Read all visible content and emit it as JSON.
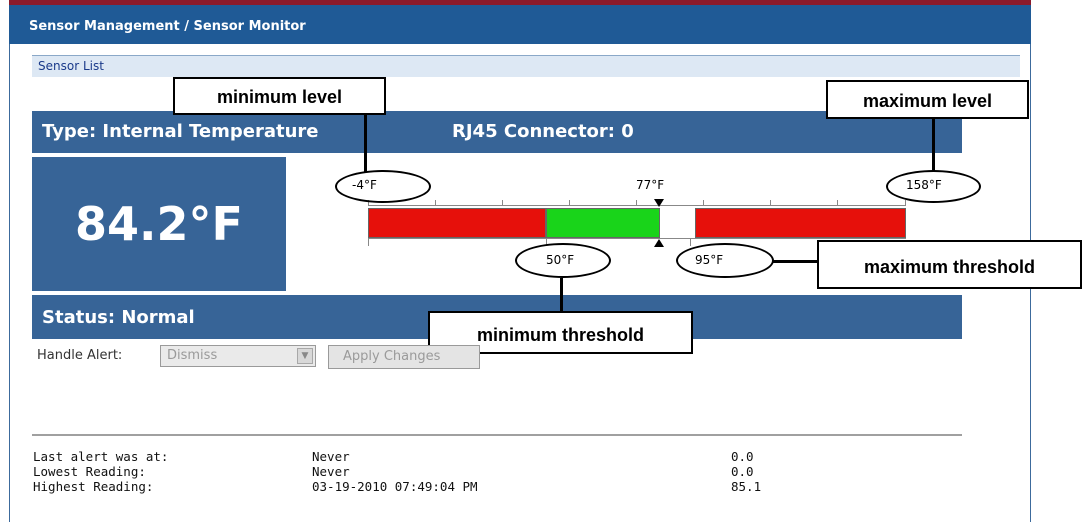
{
  "header": {
    "title": "Sensor Management / Sensor Monitor"
  },
  "nav": {
    "sensor_list_link": "Sensor List"
  },
  "sensor": {
    "type_label": "Type: Internal Temperature",
    "connector_label": "RJ45 Connector: 0",
    "current_reading": "84.2°F",
    "status_label": "Status: Normal"
  },
  "gauge": {
    "min_level": "-4°F",
    "setpoint": "77°F",
    "max_level": "158°F",
    "min_threshold": "50°F",
    "max_threshold": "95°F",
    "colors": {
      "alarm": "#e6100b",
      "normal": "#19d41a"
    }
  },
  "annotations": {
    "minimum_level": "minimum level",
    "maximum_level": "maximum level",
    "minimum_threshold": "minimum threshold",
    "maximum_threshold": "maximum threshold"
  },
  "alert_controls": {
    "handle_alert_label": "Handle Alert:",
    "selected_option": "Dismiss",
    "apply_button": "Apply Changes"
  },
  "statistics": [
    {
      "label": "Last alert was at:",
      "time": "Never",
      "value": "0.0"
    },
    {
      "label": "Lowest Reading:",
      "time": "Never",
      "value": "0.0"
    },
    {
      "label": "Highest Reading:",
      "time": "03-19-2010 07:49:04 PM",
      "value": "85.1"
    }
  ]
}
